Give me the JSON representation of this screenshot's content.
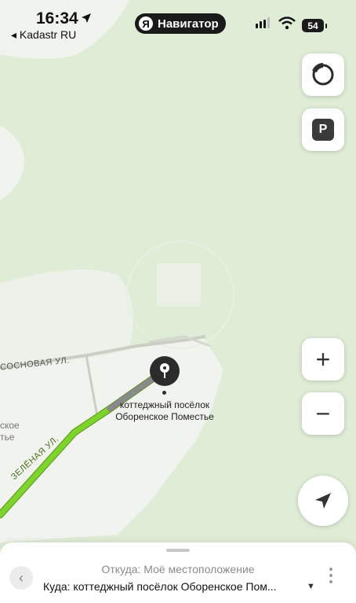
{
  "status_bar": {
    "time": "16:34",
    "back_app_label": "◂ Kadastr RU",
    "app_pill_label": "Навигатор",
    "app_pill_logo": "Я",
    "battery_level": "54"
  },
  "map": {
    "poi_label_line1": "коттеджный посёлок",
    "poi_label_line2": "Оборенское Поместье",
    "street_sosnovaya": "СОСНОВАЯ УЛ.",
    "street_zelenaya": "ЗЕЛЁНАЯ УЛ.",
    "place_fragment_line1": "ское",
    "place_fragment_line2": "тье",
    "route_color": "#7cd629",
    "route_tail_color": "#8a8a8a",
    "land_color": "#dfecd6",
    "settlement_color": "#f1f3ee"
  },
  "controls": {
    "layers_icon": "circle-layers-icon",
    "parking_label": "P",
    "zoom_in_label": "+",
    "zoom_out_label": "−",
    "locate_icon": "navigation-arrow-icon"
  },
  "route_sheet": {
    "from_text": "Откуда: Моё местоположение",
    "to_text": "Куда: коттеджный посёлок Оборенское Пом...",
    "back_label": "‹"
  }
}
